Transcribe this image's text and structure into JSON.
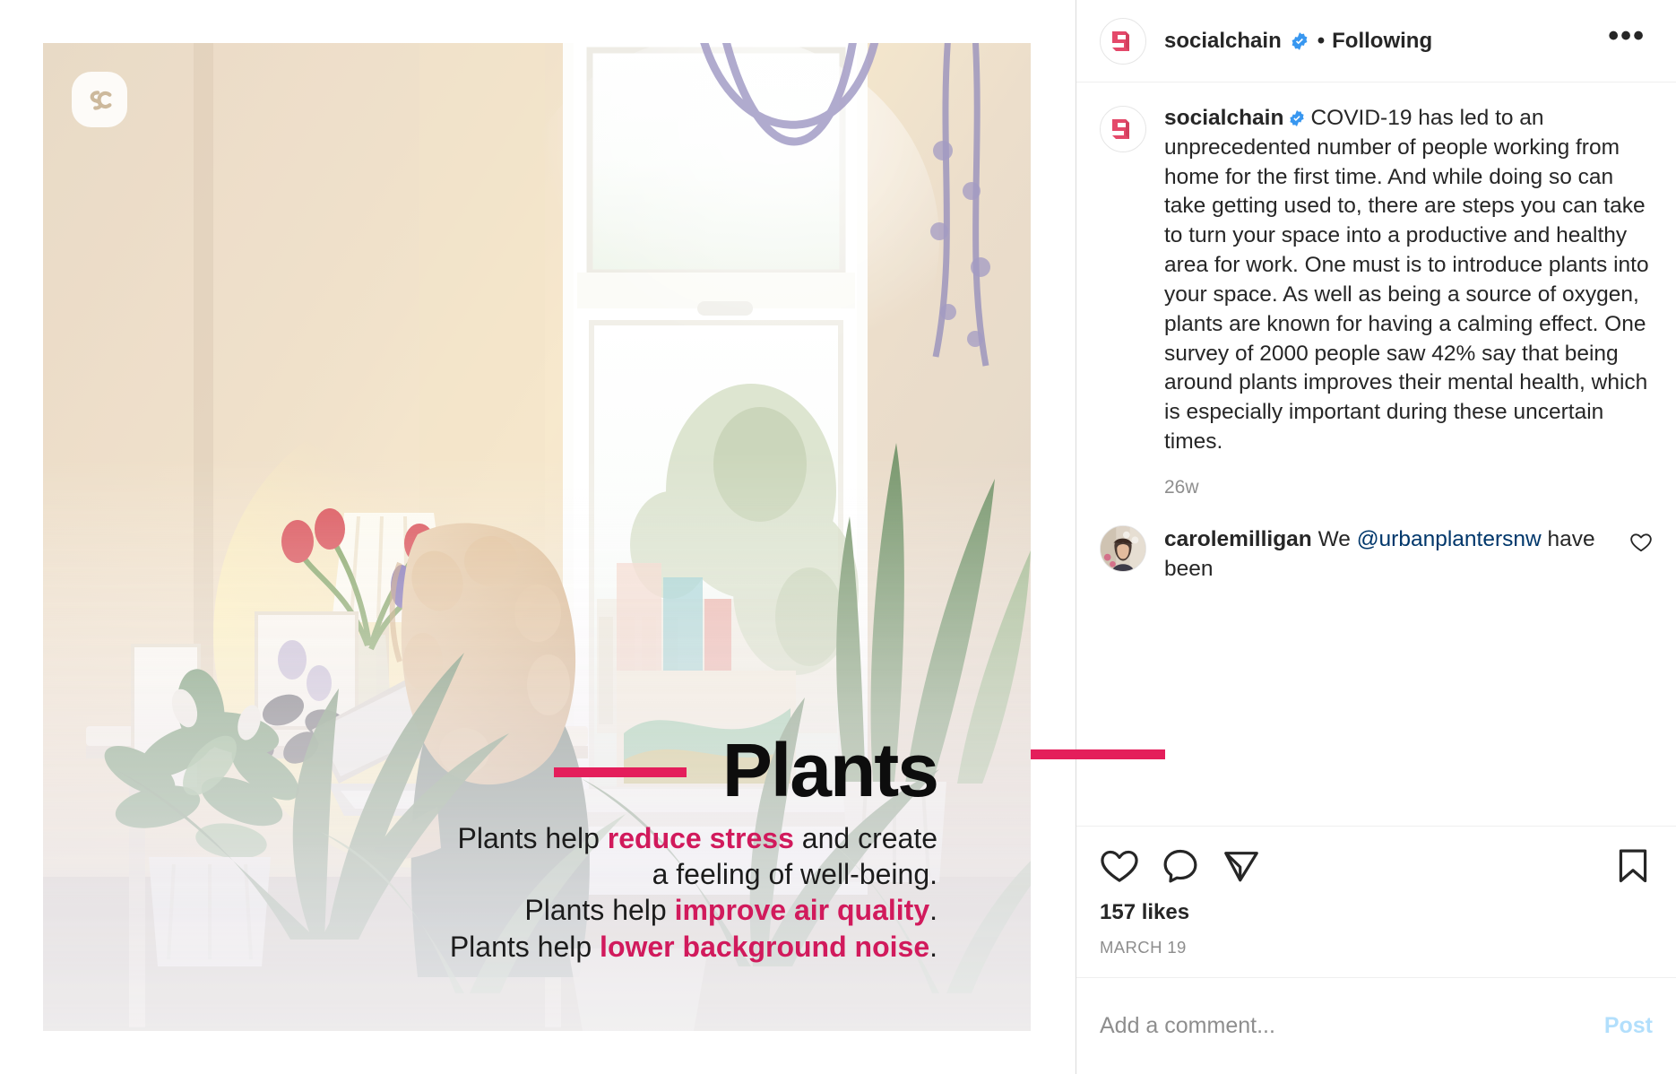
{
  "header": {
    "avatar_icon": "socialchain-logo-icon",
    "username": "socialchain",
    "verified_icon": "verified-badge-icon",
    "separator": "•",
    "follow_state": "Following",
    "more_options": "•••"
  },
  "media": {
    "brand_badge_icon": "sc-monogram-icon",
    "alt": "Woman working on a laptop at a sunlit desk surrounded by houseplants",
    "overlay": {
      "headline": "Plants",
      "lines": [
        {
          "parts": [
            {
              "t": "Plants help ",
              "accent": false
            },
            {
              "t": "reduce stress",
              "accent": true
            },
            {
              "t": " and create",
              "accent": false
            }
          ]
        },
        {
          "parts": [
            {
              "t": "a feeling of well-being.",
              "accent": false
            }
          ]
        },
        {
          "parts": [
            {
              "t": "Plants help ",
              "accent": false
            },
            {
              "t": "improve air quality",
              "accent": true
            },
            {
              "t": ".",
              "accent": false
            }
          ]
        },
        {
          "parts": [
            {
              "t": "Plants help ",
              "accent": false
            },
            {
              "t": "lower background noise",
              "accent": true
            },
            {
              "t": ".",
              "accent": false
            }
          ]
        }
      ],
      "accent_color": "#d11a5c",
      "rule_color": "#e41e5b"
    }
  },
  "caption": {
    "avatar_icon": "socialchain-logo-icon",
    "username": "socialchain",
    "verified_icon": "verified-badge-icon",
    "body": "COVID-19 has led to an unprecedented number of people working from home for the first time. And while doing so can take getting used to, there are steps you can take to turn your space into a productive and healthy area for work. One must is to introduce plants into your space. As well as being a source of oxygen, plants are known for having a calming effect. One survey of 2000 people saw 42% say that being around plants improves their mental health, which is especially important during these uncertain times.",
    "timeago": "26w"
  },
  "comments": [
    {
      "avatar_icon": "user-photo-avatar",
      "username": "carolemilligan",
      "text_before": " We ",
      "mention": "@urbanplantersnw",
      "text_after": " have been",
      "like_icon": "heart-outline-icon"
    }
  ],
  "actions": {
    "like_icon": "heart-outline-icon",
    "comment_icon": "comment-bubble-icon",
    "share_icon": "share-paper-plane-icon",
    "save_icon": "bookmark-outline-icon",
    "likes": "157 likes",
    "date": "MARCH 19"
  },
  "add_comment": {
    "placeholder": "Add a comment...",
    "value": "",
    "post_label": "Post",
    "post_color": "#b2dffc"
  },
  "theme": {
    "brand_pink": "#e4496a",
    "accent_pink": "#e41e5b",
    "verified_blue": "#3897f0",
    "text_primary": "#262626",
    "text_muted": "#8e8e8e",
    "divider": "#efefef"
  }
}
